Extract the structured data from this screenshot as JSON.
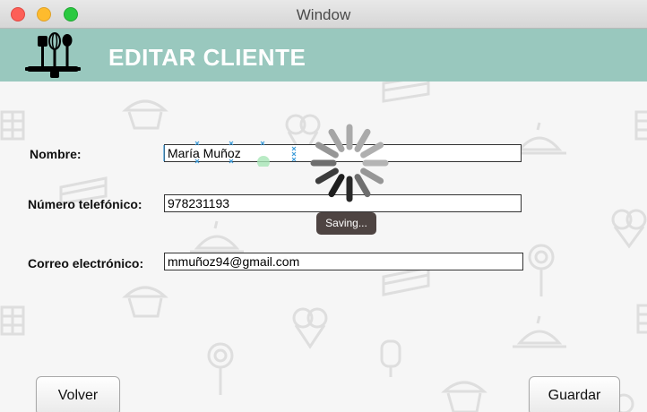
{
  "window": {
    "title": "Window"
  },
  "header": {
    "title": "EDITAR CLIENTE",
    "logo_icon": "kitchen-utensils-icon",
    "background": "#99c8be"
  },
  "form": {
    "nombre": {
      "label": "Nombre:",
      "value": "María Muñoz"
    },
    "telefono": {
      "label": "Número telefónico:",
      "value": "978231193"
    },
    "correo": {
      "label": "Correo electrónico:",
      "value": "mmuñoz94@gmail.com"
    }
  },
  "status": {
    "saving_label": "Saving..."
  },
  "buttons": {
    "back_label": "Volver",
    "save_label": "Guardar"
  },
  "background_icons": [
    "cake-slice-icon",
    "cupcake-icon",
    "ice-cream-icon",
    "lollipop-icon",
    "bundt-cake-icon",
    "popsicle-icon",
    "chocolate-bar-icon"
  ]
}
